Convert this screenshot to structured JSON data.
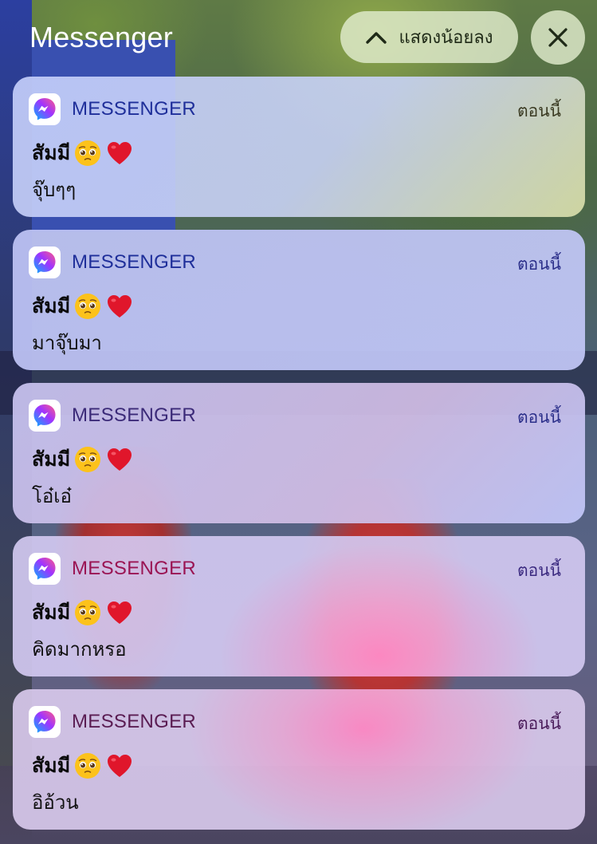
{
  "header": {
    "title": "Messenger",
    "show_less_label": "แสดงน้อยลง",
    "chevron_icon": "chevron-up-icon",
    "close_icon": "close-icon"
  },
  "notifications": [
    {
      "app_name": "MESSENGER",
      "timestamp": "ตอนนี้",
      "sender": "สัมมี",
      "sender_emojis": [
        "pleading-face-emoji",
        "red-heart-emoji"
      ],
      "message": "จุ๊บๆๆ"
    },
    {
      "app_name": "MESSENGER",
      "timestamp": "ตอนนี้",
      "sender": "สัมมี",
      "sender_emojis": [
        "pleading-face-emoji",
        "red-heart-emoji"
      ],
      "message": "มาจุ๊บมา"
    },
    {
      "app_name": "MESSENGER",
      "timestamp": "ตอนนี้",
      "sender": "สัมมี",
      "sender_emojis": [
        "pleading-face-emoji",
        "red-heart-emoji"
      ],
      "message": "โอ๋เอ๋"
    },
    {
      "app_name": "MESSENGER",
      "timestamp": "ตอนนี้",
      "sender": "สัมมี",
      "sender_emojis": [
        "pleading-face-emoji",
        "red-heart-emoji"
      ],
      "message": "คิดมากหรอ"
    },
    {
      "app_name": "MESSENGER",
      "timestamp": "ตอนนี้",
      "sender": "สัมมี",
      "sender_emojis": [
        "pleading-face-emoji",
        "red-heart-emoji"
      ],
      "message": "อิอ้วน"
    }
  ],
  "colors": {
    "messenger_gradient_start": "#00b2ff",
    "messenger_gradient_mid": "#a033ff",
    "messenger_gradient_end": "#ff5c87",
    "heart": "#e0162b",
    "emoji_face": "#fcc21b"
  }
}
